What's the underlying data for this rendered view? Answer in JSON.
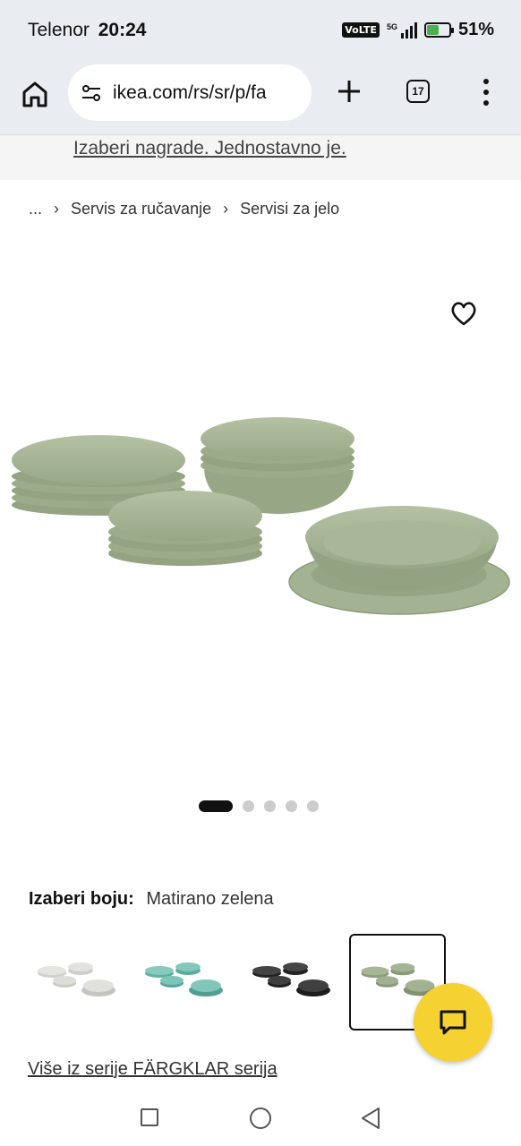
{
  "status_bar": {
    "carrier": "Telenor",
    "time": "20:24",
    "volte": "VoLTE",
    "network": "5G",
    "battery_percent": "51%",
    "battery_level": 0.51
  },
  "browser": {
    "url": "ikea.com/rs/sr/p/fa",
    "tab_count": "17"
  },
  "promo": {
    "text": "Izaberi nagrade. Jednostavno je."
  },
  "breadcrumb": {
    "ellipsis": "...",
    "items": [
      "Servis za ručavanje",
      "Servisi za jelo"
    ]
  },
  "product": {
    "color_label": "Izaberi boju:",
    "color_value": "Matirano zelena",
    "carousel_total": 5,
    "carousel_active": 1,
    "swatches": [
      {
        "name": "white",
        "color": "#dcdcd8"
      },
      {
        "name": "turquoise",
        "color": "#7ec4b8"
      },
      {
        "name": "dark-grey",
        "color": "#3a3a3a"
      },
      {
        "name": "matte-green",
        "color": "#9fb08c"
      }
    ],
    "series_link": "Više iz serije FÄRGKLAR serija"
  },
  "colors": {
    "plate_green": "#a7b496",
    "chat_yellow": "#f5d132"
  }
}
